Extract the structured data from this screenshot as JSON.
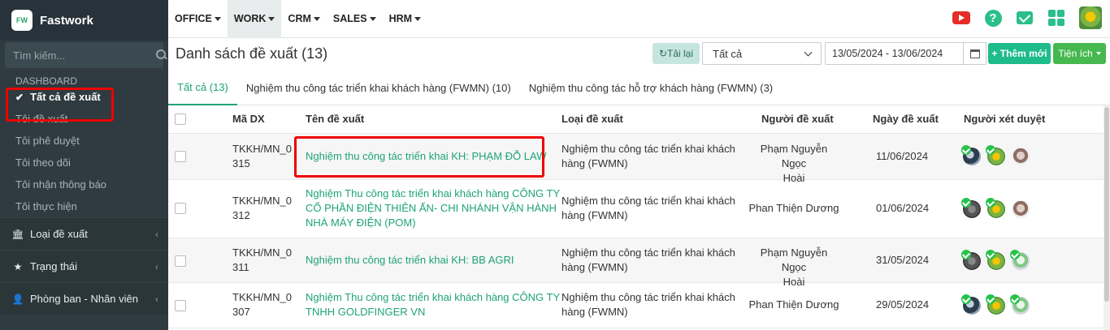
{
  "brand": {
    "logo_text": "FW",
    "name": "Fastwork"
  },
  "sidebar": {
    "search_placeholder": "Tìm kiếm...",
    "section_label": "DASHBOARD",
    "items": [
      {
        "label": "Tất cả đề xuất"
      },
      {
        "label": "Tôi đề xuất"
      },
      {
        "label": "Tôi phê duyệt"
      },
      {
        "label": "Tôi theo dõi"
      },
      {
        "label": "Tôi nhận thông báo"
      },
      {
        "label": "Tôi thực hiện"
      }
    ],
    "groups": [
      {
        "label": "Loại đề xuất",
        "icon": "bank-icon"
      },
      {
        "label": "Trạng thái",
        "icon": "star-icon"
      },
      {
        "label": "Phòng ban - Nhân viên",
        "icon": "user-icon"
      }
    ]
  },
  "topmenu": [
    "OFFICE",
    "WORK",
    "CRM",
    "SALES",
    "HRM"
  ],
  "topicons": [
    "youtube-icon",
    "help-icon",
    "mail-icon",
    "apps-icon",
    "user-avatar"
  ],
  "page": {
    "title": "Danh sách đề xuất (13)",
    "reload_label": "Tải lại",
    "filter_value": "Tất cả",
    "date_range": "13/05/2024 - 13/06/2024",
    "add_label": "+ Thêm mới",
    "tools_label": "Tiện ích"
  },
  "tabs": [
    {
      "label": "Tất cả (13)",
      "active": true
    },
    {
      "label": "Nghiệm thu công tác triển khai khách hàng (FWMN) (10)"
    },
    {
      "label": "Nghiệm thu công tác hỗ trợ khách hàng (FWMN) (3)"
    }
  ],
  "table": {
    "headers": [
      "Mã DX",
      "Tên đề xuất",
      "Loại đề xuất",
      "Người đề xuất",
      "Ngày đề xuất",
      "Người xét duyệt"
    ],
    "rows": [
      {
        "code": [
          "TKKH/MN_0",
          "315"
        ],
        "name": [
          "Nghiệm thu công tác triển khai KH: PHẠM ĐỖ LAW"
        ],
        "type": [
          "Nghiệm thu công tác triển khai khách",
          "hàng (FWMN)"
        ],
        "proposer": [
          "Phạm Nguyễn Ngọc",
          "Hoài"
        ],
        "date": "11/06/2024"
      },
      {
        "code": [
          "TKKH/MN_0",
          "312"
        ],
        "name": [
          "Nghiệm Thu công tác triển khai khách hàng CÔNG TY",
          "CỔ PHẦN ĐIỆN THIÊN ẤN- CHI NHÁNH VẬN HÀNH",
          "NHÀ MÁY ĐIỆN (POM)"
        ],
        "type": [
          "Nghiệm thu công tác triển khai khách",
          "hàng (FWMN)"
        ],
        "proposer": [
          "Phan Thiện Dương"
        ],
        "date": "01/06/2024"
      },
      {
        "code": [
          "TKKH/MN_0",
          "311"
        ],
        "name": [
          "Nghiệm thu công tác triển khai KH: BB AGRI"
        ],
        "type": [
          "Nghiệm thu công tác triển khai khách",
          "hàng (FWMN)"
        ],
        "proposer": [
          "Phạm Nguyễn Ngọc",
          "Hoài"
        ],
        "date": "31/05/2024"
      },
      {
        "code": [
          "TKKH/MN_0",
          "307"
        ],
        "name": [
          "Nghiệm Thu công tác triển khai khách hàng CÔNG TY",
          "TNHH GOLDFINGER VN"
        ],
        "type": [
          "Nghiệm thu công tác triển khai khách",
          "hàng (FWMN)"
        ],
        "proposer": [
          "Phan Thiện Dương"
        ],
        "date": "29/05/2024"
      }
    ]
  }
}
